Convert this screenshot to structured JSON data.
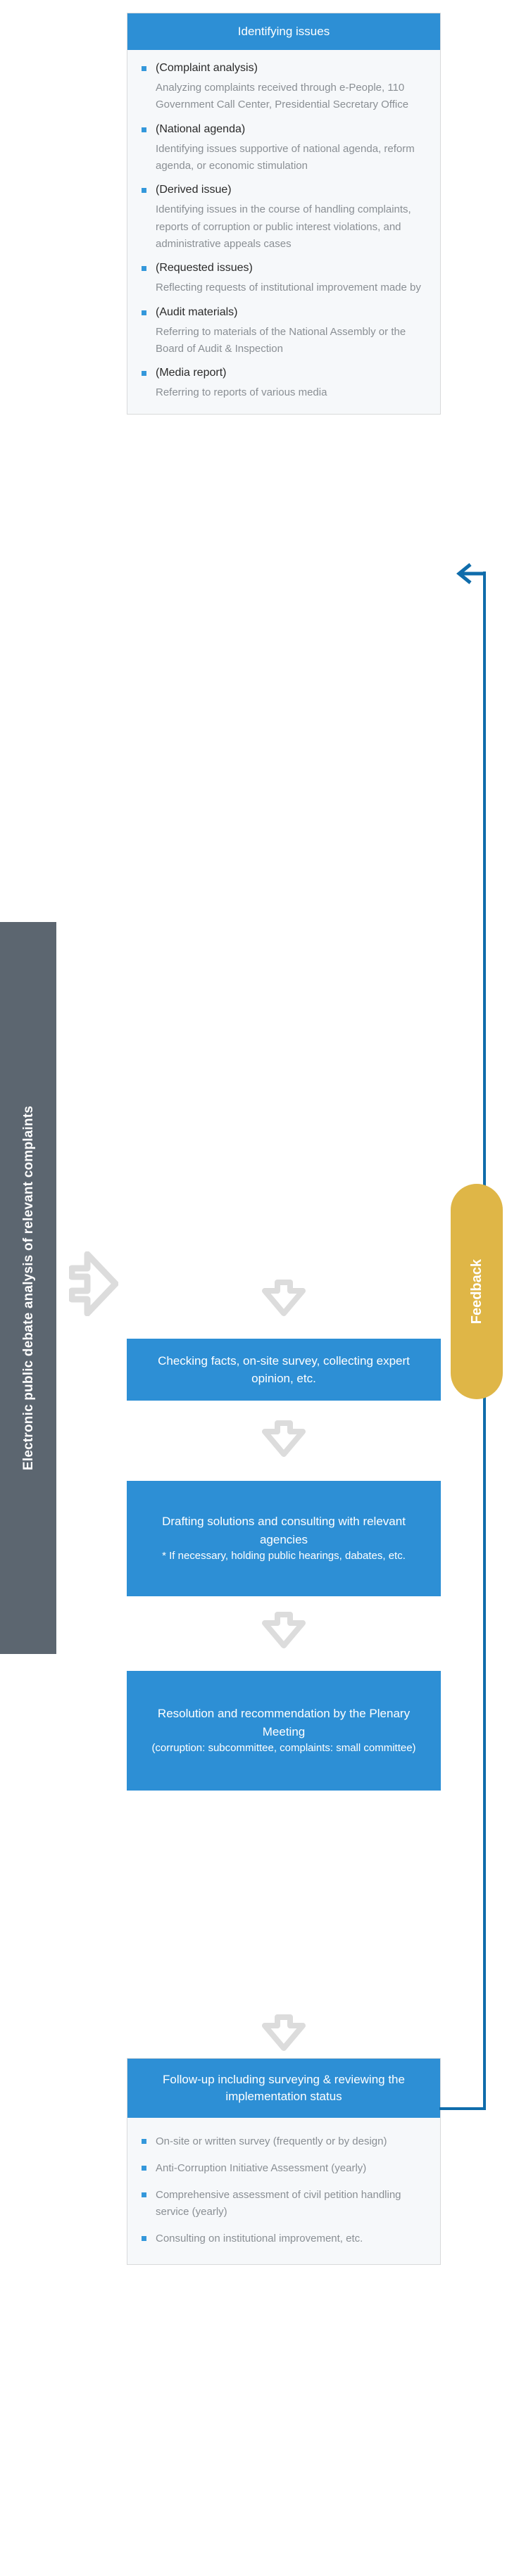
{
  "side_label": {
    "text": "Electronic public debate analysis of relevant complaints",
    "color": "#5c6670"
  },
  "feedback": {
    "label": "Feedback",
    "color": "#dfb647",
    "line_color": "#0f6cab"
  },
  "colors": {
    "accent_blue": "#2d8fd5",
    "bullet_blue": "#3498db",
    "panel_bg": "#f6f8fa",
    "panel_border": "#d9dadb",
    "body_text": "#8a8f94",
    "title_text": "#2a2a2a",
    "arrow_gray": "#dcdcdc"
  },
  "steps": [
    {
      "id": "identifying-issues",
      "header": "Identifying issues",
      "items": [
        {
          "title": "(Complaint analysis)",
          "body": "Analyzing complaints received through e-People, 110 Government Call Center, Presidential Secretary Office"
        },
        {
          "title": "(National agenda)",
          "body": "Identifying issues supportive of national agenda, reform agenda, or economic stimulation"
        },
        {
          "title": "(Derived issue)",
          "body": "Identifying issues in the course of handling complaints, reports of corruption or public interest violations, and administrative appeals cases"
        },
        {
          "title": "(Requested issues)",
          "body": "Reflecting requests of institutional improvement made by"
        },
        {
          "title": "(Audit materials)",
          "body": "Referring to materials of the National Assembly or the Board of Audit & Inspection"
        },
        {
          "title": "(Media report)",
          "body": "Referring to reports of various media"
        }
      ]
    },
    {
      "id": "checking-facts",
      "text": "Checking facts, on-site survey, collecting expert opinion, etc."
    },
    {
      "id": "drafting-solutions",
      "text": "Drafting solutions and consulting with relevant agencies",
      "sub": "* If necessary, holding public hearings, dabates, etc."
    },
    {
      "id": "resolution-recommendation",
      "text": "Resolution and recommendation by the Plenary Meeting",
      "sub": "(corruption: subcommittee, complaints: small committee)"
    },
    {
      "id": "follow-up",
      "header": "Follow-up including surveying & reviewing the implementation status",
      "bullets": [
        "On-site or written survey (frequently or by design)",
        "Anti-Corruption Initiative Assessment (yearly)",
        "Comprehensive assessment of civil petition handling service (yearly)",
        "Consulting on institutional improvement, etc."
      ]
    }
  ]
}
